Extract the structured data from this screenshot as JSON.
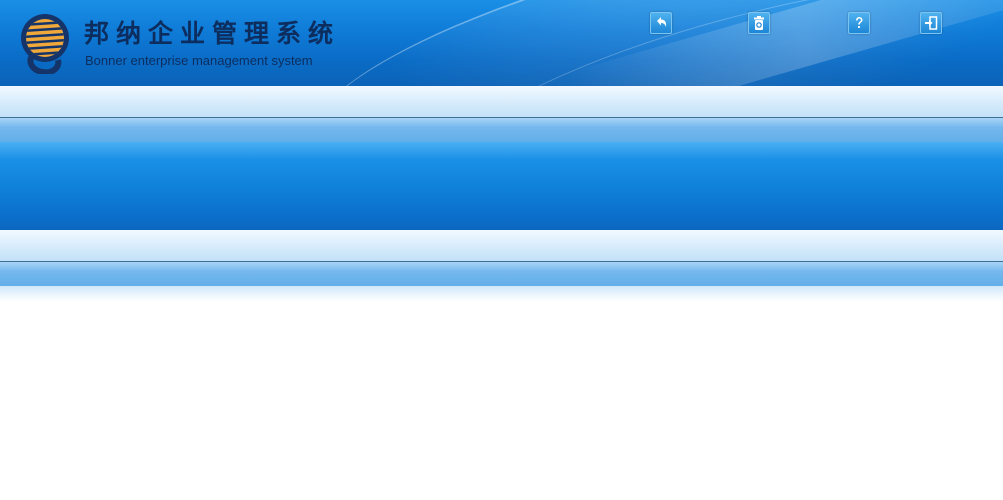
{
  "header": {
    "title": "邦纳企业管理系统",
    "subtitle": "Bonner enterprise management system"
  },
  "toolbar": [
    {
      "name": "back-button",
      "icon": "back-arrow-icon"
    },
    {
      "name": "recycle-bin-button",
      "icon": "recycle-bin-icon"
    },
    {
      "name": "help-button",
      "icon": "help-icon"
    },
    {
      "name": "logout-button",
      "icon": "logout-icon"
    }
  ],
  "colors": {
    "header_blue": "#0f7cd8",
    "brand_text": "#0d2d5e",
    "logo_orange": "#e89a2c",
    "logo_navy": "#15356a"
  }
}
